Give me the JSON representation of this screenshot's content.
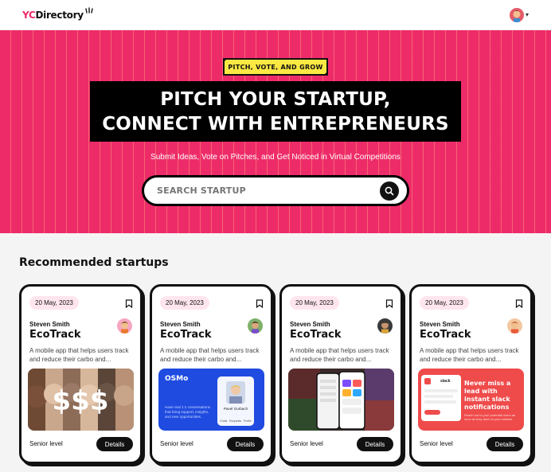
{
  "nav": {
    "logo_yc": "YC",
    "logo_rest": "Directory",
    "user_avatar": "user-avatar"
  },
  "hero": {
    "tag": "PITCH, VOTE, AND GROW",
    "headline_line1": "PITCH YOUR STARTUP,",
    "headline_line2": "CONNECT WITH ENTREPRENEURS",
    "subline": "Submit Ideas, Vote on Pitches, and Get Noticed in Virtual Competitions",
    "search_placeholder": "SEARCH STARTUP"
  },
  "section_title": "Recommended startups",
  "colors": {
    "accent": "#ee2b69",
    "tag_yellow": "#fbe843",
    "dark": "#111111"
  },
  "cards": [
    {
      "date": "20 May, 2023",
      "author": "Steven Smith",
      "title": "EcoTrack",
      "description": "A mobile app that helps users track and reduce their carbo and...",
      "level": "Senior level",
      "details": "Details"
    },
    {
      "date": "20 May, 2023",
      "author": "Steven Smith",
      "title": "EcoTrack",
      "description": "A mobile app that helps users track and reduce their carbo and...",
      "level": "Senior level",
      "details": "Details",
      "thumb_brand": "OSMo",
      "thumb_text": "Have real 1:1 conversations that bring support, insights, and new opportunities.",
      "thumb_name": "Pavel Gurbach",
      "thumb_tabs": [
        "Chats",
        "Requests",
        "Profile"
      ]
    },
    {
      "date": "20 May, 2023",
      "author": "Steven Smith",
      "title": "EcoTrack",
      "description": "A mobile app that helps users track and reduce their carbo and...",
      "level": "Senior level",
      "details": "Details"
    },
    {
      "date": "20 May, 2023",
      "author": "Steven Smith",
      "title": "EcoTrack",
      "description": "A mobile app that helps users track and reduce their carbo and...",
      "level": "Senior level",
      "details": "Details",
      "thumb_headline": "Never miss a lead with instant slack notifications",
      "thumb_sub": "Reach out to your potential users as soon as they land on your website",
      "thumb_brand": "slack"
    }
  ]
}
